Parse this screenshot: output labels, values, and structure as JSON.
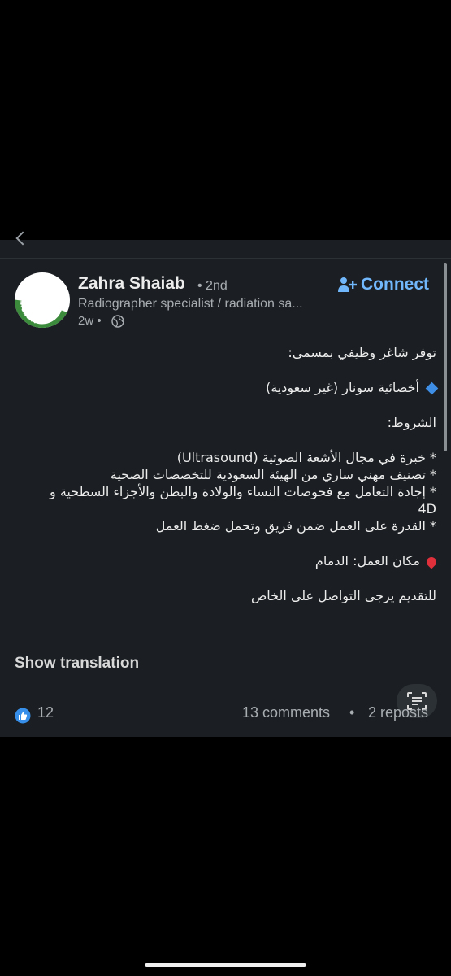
{
  "post": {
    "author_name": "Zahra Shaiab",
    "degree": "• 2nd",
    "headline": "Radiographer specialist / radiation sa...",
    "time": "2w •",
    "connect_label": "Connect",
    "avatar_text": "OPENTOWORK",
    "lines": {
      "l1": "توفر شاغر وظيفي بمسمى:",
      "l2": "أخصائية سونار (غير سعودية)",
      "l3": "الشروط:",
      "l4": "* خبرة في مجال الأشعة الصوتية (Ultrasound)",
      "l5": "* تصنيف مهني ساري من الهيئة السعودية للتخصصات الصحية",
      "l6": "* إجادة التعامل مع فحوصات النساء والولادة والبطن والأجزاء السطحية و 4D",
      "l7": "* القدرة على العمل ضمن فريق وتحمل ضغط العمل",
      "l8": "مكان العمل: الدمام",
      "l9": "للتقديم يرجى التواصل على الخاص"
    },
    "show_translation": "Show translation",
    "likes": "12",
    "comments": "13 comments",
    "separator": "•",
    "reposts": "2 reposts"
  },
  "colors": {
    "background": "#000000",
    "card": "#1b1f23",
    "accent": "#71b7fb",
    "opentowork": "#3c8a3c"
  },
  "icons": [
    "back-icon",
    "globe-icon",
    "add-person-icon",
    "diamond-icon",
    "pin-icon",
    "translate-icon",
    "like-icon"
  ]
}
